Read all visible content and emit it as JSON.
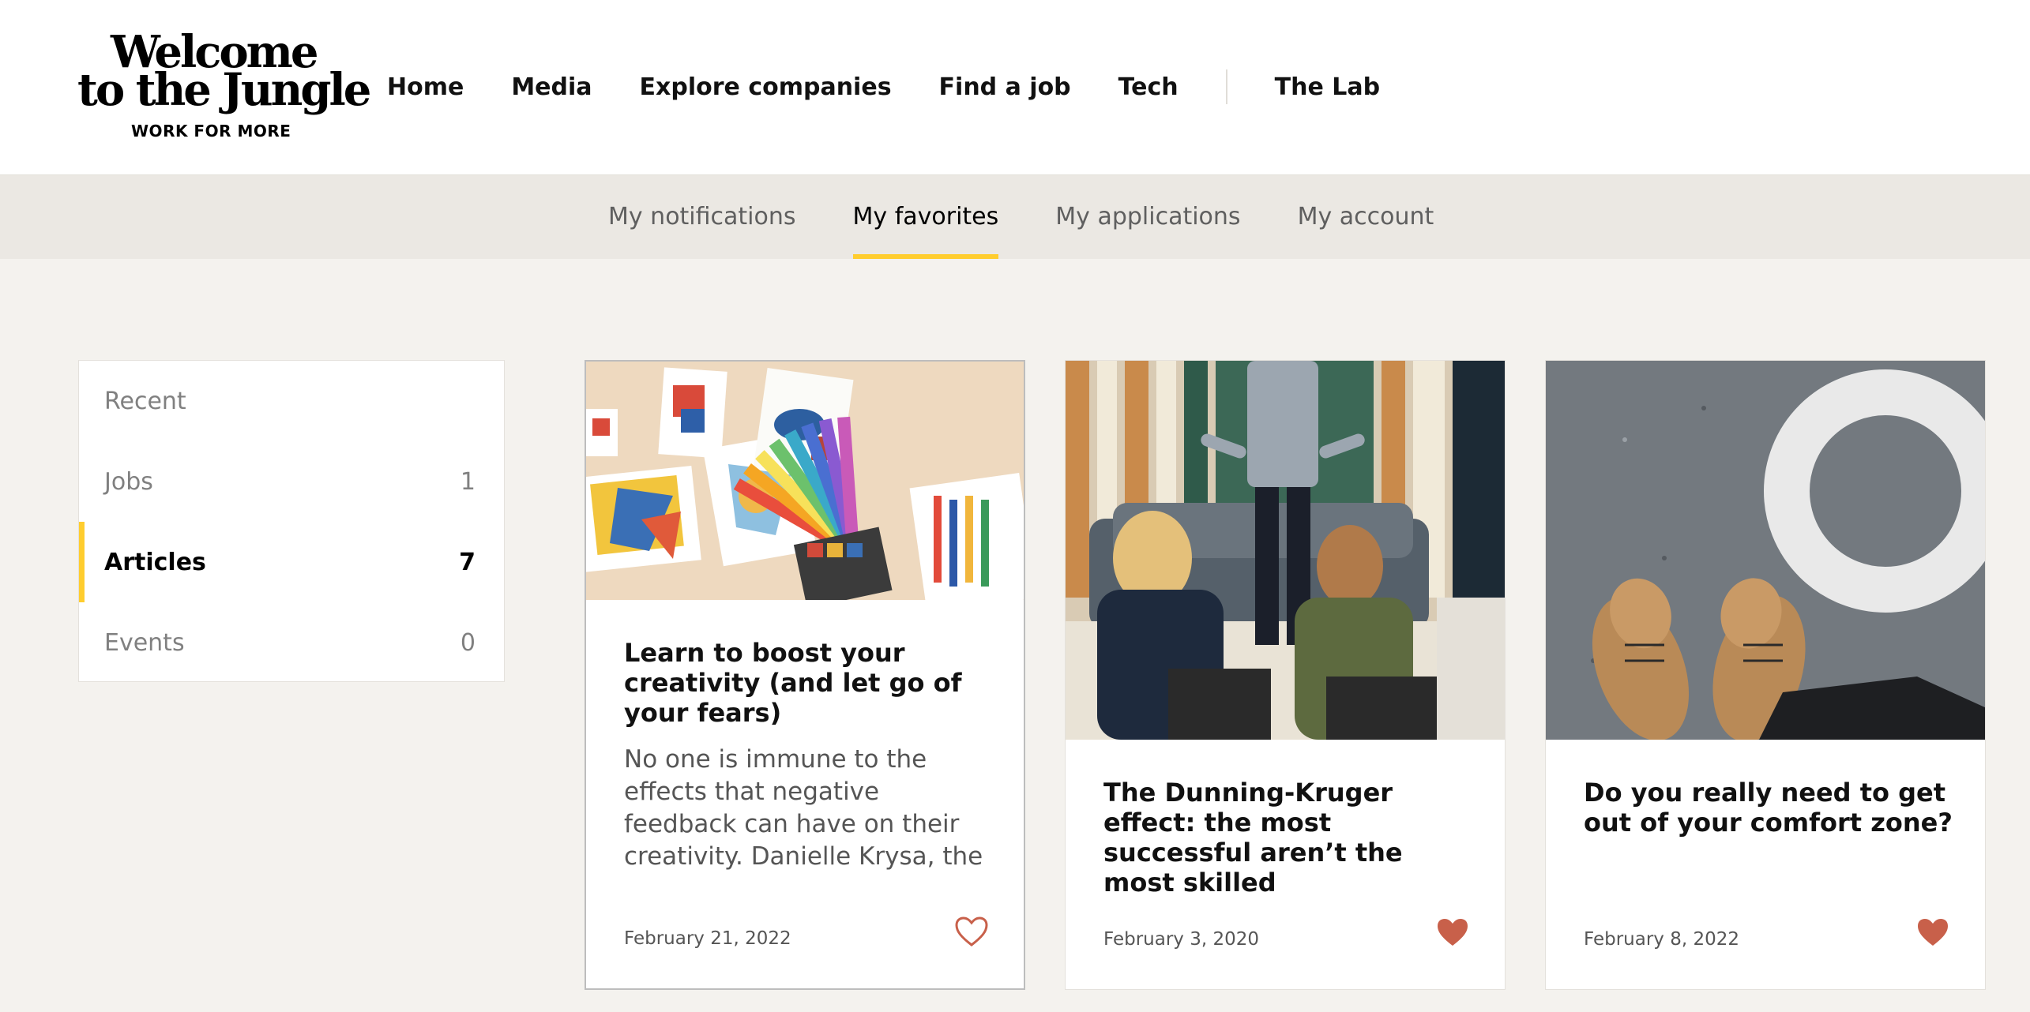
{
  "header": {
    "logo_line1": "Welcome",
    "logo_line2": "to the Jungle",
    "logo_tagline": "WORK FOR MORE",
    "nav": [
      {
        "label": "Home"
      },
      {
        "label": "Media"
      },
      {
        "label": "Explore companies"
      },
      {
        "label": "Find a job"
      },
      {
        "label": "Tech"
      },
      {
        "label": "The Lab"
      }
    ]
  },
  "subnav": {
    "tabs": [
      {
        "label": "My notifications",
        "active": false
      },
      {
        "label": "My favorites",
        "active": true
      },
      {
        "label": "My applications",
        "active": false
      },
      {
        "label": "My account",
        "active": false
      }
    ],
    "accent": "#ffcd2e"
  },
  "sidebar": {
    "items": [
      {
        "label": "Recent",
        "count": ""
      },
      {
        "label": "Jobs",
        "count": "1"
      },
      {
        "label": "Articles",
        "count": "7",
        "active": true
      },
      {
        "label": "Events",
        "count": "0"
      }
    ]
  },
  "cards": [
    {
      "image_icon": "art-supplies-image",
      "title": "Learn to boost your creativity (and let go of your fears)",
      "excerpt": "No one is immune to the effects that negative feedback can have on their creativity. Danielle Krysa, the author of Your Inner Critic is a Big Jerk",
      "date": "February 21, 2022",
      "favorited": false
    },
    {
      "image_icon": "presentation-audience-image",
      "title": "The Dunning-Kruger effect: the most successful aren’t the most skilled",
      "excerpt": "",
      "date": "February 3, 2020",
      "favorited": true
    },
    {
      "image_icon": "shoes-on-pavement-image",
      "title": "Do you really need to get out of your comfort zone?",
      "excerpt": "",
      "date": "February 8, 2022",
      "favorited": true
    }
  ],
  "colors": {
    "heart": "#c8604a",
    "page_bg": "#f4f2ee",
    "subnav_bg": "#ebe8e3"
  }
}
